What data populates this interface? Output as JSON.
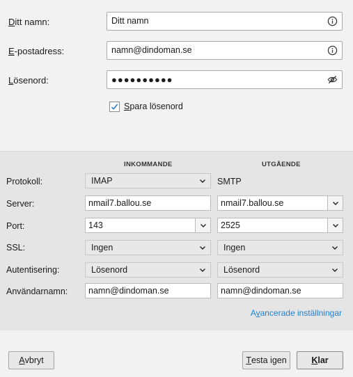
{
  "account": {
    "name_label_u": "D",
    "name_label_rest": "itt namn:",
    "name_value": "Ditt namn",
    "email_label_u": "E",
    "email_label_rest": "-postadress:",
    "email_value": "namn@dindoman.se",
    "password_label_u": "L",
    "password_label_rest": "ösenord:",
    "password_dots": "●●●●●●●●●●",
    "save_password_u": "S",
    "save_password_rest": "para lösenord",
    "save_password_checked": true
  },
  "servers": {
    "incoming_heading": "INKOMMANDE",
    "outgoing_heading": "UTGÅENDE",
    "labels": {
      "protocol": "Protokoll:",
      "server": "Server:",
      "port": "Port:",
      "ssl": "SSL:",
      "auth": "Autentisering:",
      "username": "Användarnamn:"
    },
    "incoming": {
      "protocol": "IMAP",
      "server": "nmail7.ballou.se",
      "port": "143",
      "ssl": "Ingen",
      "auth": "Lösenord",
      "username": "namn@dindoman.se"
    },
    "outgoing": {
      "protocol": "SMTP",
      "server": "nmail7.ballou.se",
      "port": "2525",
      "ssl": "Ingen",
      "auth": "Lösenord",
      "username": "namn@dindoman.se"
    },
    "advanced_link_u": "v",
    "advanced_link_pre": "A",
    "advanced_link_rest": "ancerade inställningar"
  },
  "buttons": {
    "cancel_u": "A",
    "cancel_rest": "vbryt",
    "retest_pre": "",
    "retest_u": "T",
    "retest_rest": "esta igen",
    "done_u": "K",
    "done_rest": "lar"
  },
  "colors": {
    "link": "#1e7fd1",
    "checkmark": "#1e6fc0"
  },
  "icons": [
    "info-icon",
    "eye-slash-icon",
    "check-icon",
    "chevron-down-icon"
  ]
}
